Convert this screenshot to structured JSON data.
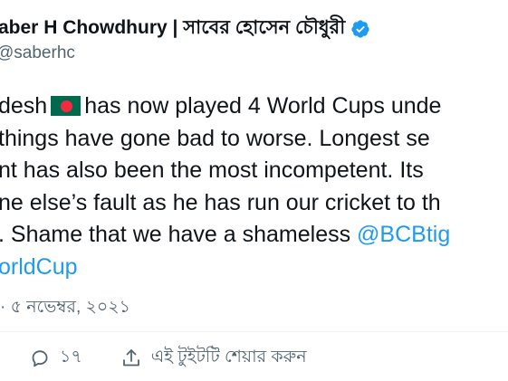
{
  "author": {
    "display_name": "aber H Chowdhury | সাবের হোসেন চৌধুরী",
    "handle": "@saberhc",
    "verified_icon": "verified-badge-icon"
  },
  "tweet": {
    "line1_before_flag": "desh",
    "flag_icon": "bangladesh-flag-icon",
    "line1_after_flag": "has now played 4 World Cups unde",
    "line2": "things have gone bad to worse. Longest se",
    "line3": "nt has also been the most incompetent. Its",
    "line4": "ne else’s fault as he has run our cricket to th",
    "line5_text": ". Shame that we have a shameless ",
    "line5_mention": "@BCBtig",
    "line6_hashtag": "orldCup"
  },
  "timestamp": "· ৫ নভেম্বর, ২০২১",
  "actions": {
    "reply_icon": "reply-bubble-icon",
    "reply_count": "১৭",
    "share_icon": "share-upload-icon",
    "share_label": "এই টুইটটি শেয়ার করুন"
  },
  "colors": {
    "text": "#0f1419",
    "secondary": "#536471",
    "link": "#1d9bf0",
    "verified": "#1d9bf0",
    "flag_green": "#006a4e",
    "flag_red": "#f42a41"
  }
}
